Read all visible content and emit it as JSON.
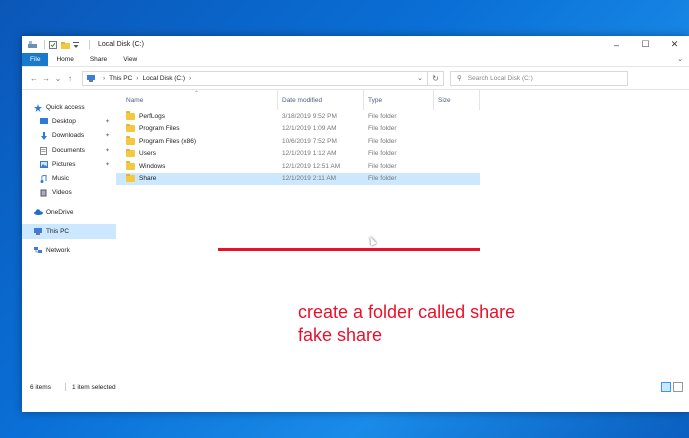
{
  "window": {
    "title": "Local Disk (C:)",
    "controls": {
      "minimize": "–",
      "maximize": "☐",
      "close": "✕"
    }
  },
  "ribbon": {
    "tabs": [
      "File",
      "Home",
      "Share",
      "View"
    ],
    "expand_glyph": "⌄"
  },
  "address_bar": {
    "breadcrumb": [
      "This PC",
      "Local Disk (C:)"
    ],
    "separator": "›",
    "search_placeholder": "Search Local Disk (C:)"
  },
  "nav_pane": {
    "quick_access": "Quick access",
    "pinned": [
      "Desktop",
      "Downloads",
      "Documents",
      "Pictures"
    ],
    "unpinned": [
      "Music",
      "Videos"
    ],
    "onedrive": "OneDrive",
    "this_pc": "This PC",
    "network": "Network",
    "pin_glyph": "📌"
  },
  "columns": {
    "name": "Name",
    "date": "Date modified",
    "type": "Type",
    "size": "Size"
  },
  "files": [
    {
      "name": "PerfLogs",
      "date": "3/18/2019 9:52 PM",
      "type": "File folder"
    },
    {
      "name": "Program Files",
      "date": "12/1/2019 1:09 AM",
      "type": "File folder"
    },
    {
      "name": "Program Files (x86)",
      "date": "10/6/2019 7:52 PM",
      "type": "File folder"
    },
    {
      "name": "Users",
      "date": "12/1/2019 1:12 AM",
      "type": "File folder"
    },
    {
      "name": "Windows",
      "date": "12/1/2019 12:51 AM",
      "type": "File folder"
    },
    {
      "name": "Share",
      "date": "12/1/2019 2:11 AM",
      "type": "File folder",
      "selected": true
    }
  ],
  "annotation": {
    "line1": "create a folder called share",
    "line2": "fake share",
    "color": "#e8102a"
  },
  "status": {
    "count": "6 items",
    "selection": "1 item selected"
  },
  "colors": {
    "accent": "#1979ca",
    "selection": "#cce8ff"
  }
}
